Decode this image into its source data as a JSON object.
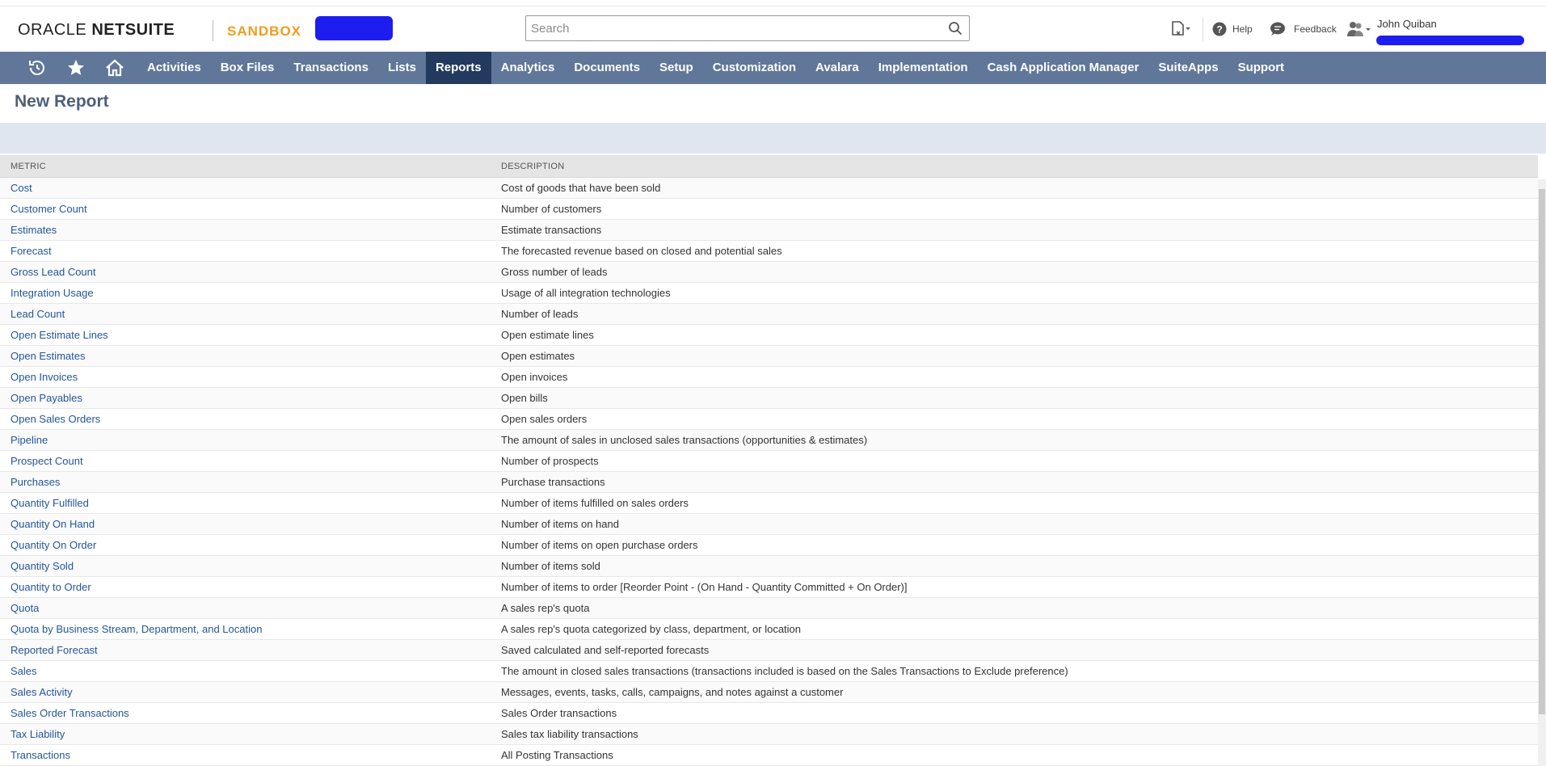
{
  "header": {
    "logo_prefix": "ORACLE ",
    "logo_suffix": "NETSUITE",
    "environment": "SANDBOX",
    "search_placeholder": "Search",
    "help": "Help",
    "feedback": "Feedback",
    "user_name": "John Quiban"
  },
  "nav": {
    "items": [
      {
        "label": "Activities"
      },
      {
        "label": "Box Files"
      },
      {
        "label": "Transactions"
      },
      {
        "label": "Lists"
      },
      {
        "label": "Reports",
        "active": true
      },
      {
        "label": "Analytics"
      },
      {
        "label": "Documents"
      },
      {
        "label": "Setup"
      },
      {
        "label": "Customization"
      },
      {
        "label": "Avalara"
      },
      {
        "label": "Implementation"
      },
      {
        "label": "Cash Application Manager"
      },
      {
        "label": "SuiteApps"
      },
      {
        "label": "Support"
      }
    ]
  },
  "page": {
    "title": "New Report"
  },
  "table": {
    "headers": {
      "metric": "METRIC",
      "description": "DESCRIPTION"
    },
    "rows": [
      {
        "metric": "Cost",
        "description": "Cost of goods that have been sold"
      },
      {
        "metric": "Customer Count",
        "description": "Number of customers"
      },
      {
        "metric": "Estimates",
        "description": "Estimate transactions"
      },
      {
        "metric": "Forecast",
        "description": "The forecasted revenue based on closed and potential sales"
      },
      {
        "metric": "Gross Lead Count",
        "description": "Gross number of leads"
      },
      {
        "metric": "Integration Usage",
        "description": "Usage of all integration technologies"
      },
      {
        "metric": "Lead Count",
        "description": "Number of leads"
      },
      {
        "metric": "Open Estimate Lines",
        "description": "Open estimate lines"
      },
      {
        "metric": "Open Estimates",
        "description": "Open estimates"
      },
      {
        "metric": "Open Invoices",
        "description": "Open invoices"
      },
      {
        "metric": "Open Payables",
        "description": "Open bills"
      },
      {
        "metric": "Open Sales Orders",
        "description": "Open sales orders"
      },
      {
        "metric": "Pipeline",
        "description": "The amount of sales in unclosed sales transactions (opportunities & estimates)"
      },
      {
        "metric": "Prospect Count",
        "description": "Number of prospects"
      },
      {
        "metric": "Purchases",
        "description": "Purchase transactions"
      },
      {
        "metric": "Quantity Fulfilled",
        "description": "Number of items fulfilled on sales orders"
      },
      {
        "metric": "Quantity On Hand",
        "description": "Number of items on hand"
      },
      {
        "metric": "Quantity On Order",
        "description": "Number of items on open purchase orders"
      },
      {
        "metric": "Quantity Sold",
        "description": "Number of items sold"
      },
      {
        "metric": "Quantity to Order",
        "description": "Number of items to order [Reorder Point - (On Hand - Quantity Committed + On Order)]"
      },
      {
        "metric": "Quota",
        "description": "A sales rep's quota"
      },
      {
        "metric": "Quota by Business Stream, Department, and Location",
        "description": "A sales rep's quota categorized by class, department, or location"
      },
      {
        "metric": "Reported Forecast",
        "description": "Saved calculated and self-reported forecasts"
      },
      {
        "metric": "Sales",
        "description": "The amount in closed sales transactions (transactions included is based on the Sales Transactions to Exclude preference)"
      },
      {
        "metric": "Sales Activity",
        "description": "Messages, events, tasks, calls, campaigns, and notes against a customer"
      },
      {
        "metric": "Sales Order Transactions",
        "description": "Sales Order transactions"
      },
      {
        "metric": "Tax Liability",
        "description": "Sales tax liability transactions"
      },
      {
        "metric": "Transactions",
        "description": "All Posting Transactions"
      }
    ]
  },
  "colors": {
    "nav_bg": "#607799",
    "nav_active": "#223a5e",
    "sandbox": "#f29b1d",
    "link": "#255599",
    "title": "#4d5f79"
  }
}
